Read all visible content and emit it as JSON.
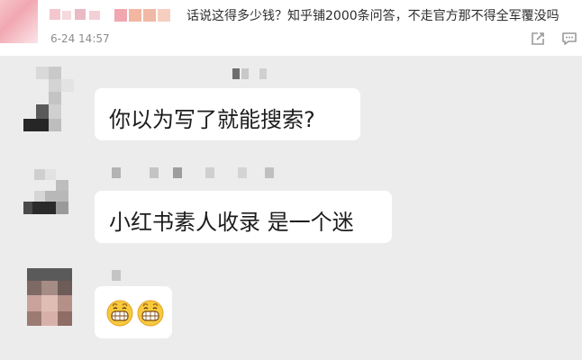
{
  "post": {
    "text": "话说这得多少钱？知乎铺2000条问答，不走官方那不得全军覆没吗",
    "time": "6-24 14:57",
    "actions": [
      "share-icon",
      "comment-icon"
    ]
  },
  "messages": [
    {
      "text": "你以为写了就能搜索?"
    },
    {
      "text": "小红书素人收录 是一个迷"
    },
    {
      "emoji": "grinning-face-icon",
      "count": 2
    }
  ],
  "colors": {
    "background": "#ececec",
    "bubble": "#ffffff",
    "text": "#1c1c1c",
    "meta": "#8c8c8c"
  }
}
